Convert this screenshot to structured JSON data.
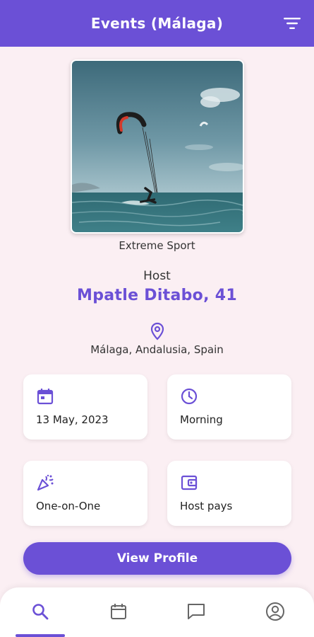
{
  "app_bar": {
    "title": "Events (Málaga)",
    "filter_icon": "filter-icon"
  },
  "event": {
    "photo": "kitesurfing-photo",
    "category": "Extreme Sport",
    "host_label": "Host",
    "host_name": "Mpatle Ditabo, 41",
    "location_icon": "location-pin-icon",
    "location": "Málaga, Andalusia, Spain"
  },
  "info_cards": [
    {
      "icon": "calendar-icon",
      "text": "13 May, 2023"
    },
    {
      "icon": "clock-icon",
      "text": "Morning"
    },
    {
      "icon": "party-popper-icon",
      "text": "One-on-One"
    },
    {
      "icon": "wallet-icon",
      "text": "Host pays"
    }
  ],
  "actions": {
    "view_profile_label": "View Profile"
  },
  "bottom_nav": {
    "items": [
      {
        "icon": "search-icon",
        "active": true
      },
      {
        "icon": "calendar-icon",
        "active": false
      },
      {
        "icon": "chat-icon",
        "active": false
      },
      {
        "icon": "profile-icon",
        "active": false
      }
    ]
  },
  "colors": {
    "primary": "#6b50d6",
    "background": "#fbeff3",
    "card": "#ffffff",
    "nav_inactive": "#666666"
  }
}
